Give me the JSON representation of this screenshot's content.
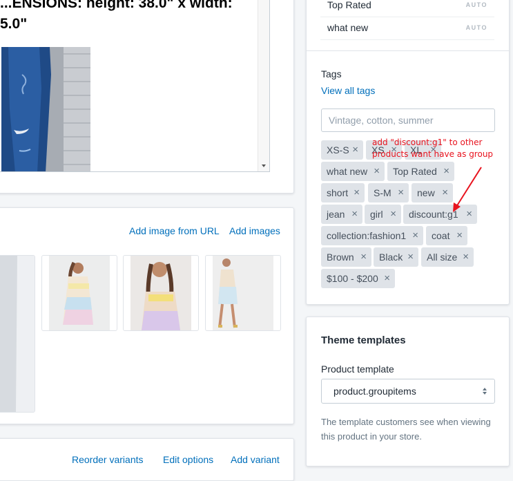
{
  "description": {
    "heading": "...ENSIONS: height: 38.0\" x width:\n5.0\""
  },
  "images": {
    "add_from_url": "Add image from URL",
    "add_images": "Add images"
  },
  "variants": {
    "reorder": "Reorder variants",
    "edit_options": "Edit options",
    "add_variant": "Add variant"
  },
  "organization": {
    "collections": [
      {
        "name": "Top Rated",
        "badge": "AUTO"
      },
      {
        "name": "what new",
        "badge": "AUTO"
      }
    ],
    "tags_label": "Tags",
    "view_all_tags": "View all tags",
    "tags_placeholder": "Vintage, cotton, summer",
    "tags": [
      "XS-S",
      "XS",
      "XL",
      "what new",
      "Top Rated",
      "short",
      "S-M",
      "new",
      "jean",
      "girl",
      "discount:g1",
      "collection:fashion1",
      "coat",
      "Brown",
      "Black",
      "All size",
      "$100 - $200"
    ],
    "tag_remove_glyph": "×",
    "annotation": "add \"discount:g1\" to other products want have as group",
    "annotation_color": "#e8131e"
  },
  "theme": {
    "title": "Theme templates",
    "product_template_label": "Product template",
    "selected_template": "product.groupitems",
    "help_text": "The template customers see when viewing this product in your store."
  },
  "colors": {
    "link": "#006fbb",
    "tag_bg": "#dfe3e8",
    "page_bg": "#f4f6f8"
  }
}
